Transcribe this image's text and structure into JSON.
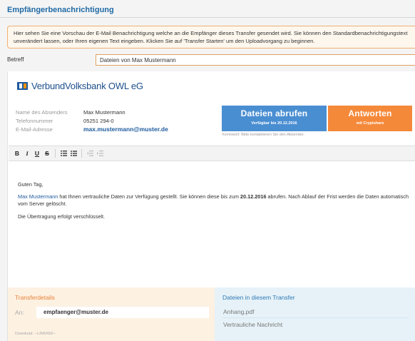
{
  "dialog": {
    "title": "Empfängerbenachrichtigung",
    "info_text": "Hier sehen Sie eine Vorschau der E-Mail Benachrichtigung welche an die Empfänger dieses Transfer gesendet wird. Sie können den Standardbenachrichtigungstext unverändert lassen, oder Ihren eigenen Text eingeben. Klicken Sie auf 'Transfer Starten' um den Uploadvorgang zu beginnen."
  },
  "subject": {
    "label": "Betreff",
    "value": "Dateien von Max Mustermann"
  },
  "email": {
    "bank_name": "VerbundVolksbank OWL eG",
    "sender": {
      "name_label": "Name des Absenders",
      "name": "Max Mustermann",
      "phone_label": "Telefonnummer",
      "phone": "05251 294-0",
      "email_label": "E-Mail-Adresse",
      "email": "max.mustermann@muster.de"
    },
    "download_button": {
      "label": "Dateien abrufen",
      "sub": "Verfügbar bis 20.12.2016"
    },
    "reply_button": {
      "label": "Antworten",
      "sub": "mit Cryptshare"
    },
    "password_hint": "Kennwort: Bitte kontaktieren Sie den Absender.",
    "editor": {
      "toolbar": {
        "bold": "B",
        "italic": "I",
        "underline": "U",
        "strike": "S"
      },
      "greeting": "Guten Tag,",
      "para1_name": "Max Mustermann",
      "para1_a": " hat Ihnen vertrauliche Daten zur Verfügung gestellt. Sie können diese bis zum ",
      "para1_date": "20.12.2016",
      "para1_b": " abrufen. Nach Ablauf der Frist werden die Daten automatisch vom Server gelöscht.",
      "para2": "Die Übertragung erfolgt verschlüsselt."
    },
    "transfer_details": {
      "title": "Transferdetails",
      "to_label": "An:",
      "to_value": "empfaenger@muster.de",
      "download_hint": "Download: --LINKREF--"
    },
    "files": {
      "title": "Dateien in diesem Transfer",
      "items": [
        "Anhang.pdf",
        "Vertrauliche Nachricht"
      ]
    }
  },
  "colors": {
    "accent_blue": "#1f6aa5",
    "download_blue": "#4a8ed2",
    "reply_orange": "#f5893a",
    "info_border": "#f0b070"
  }
}
